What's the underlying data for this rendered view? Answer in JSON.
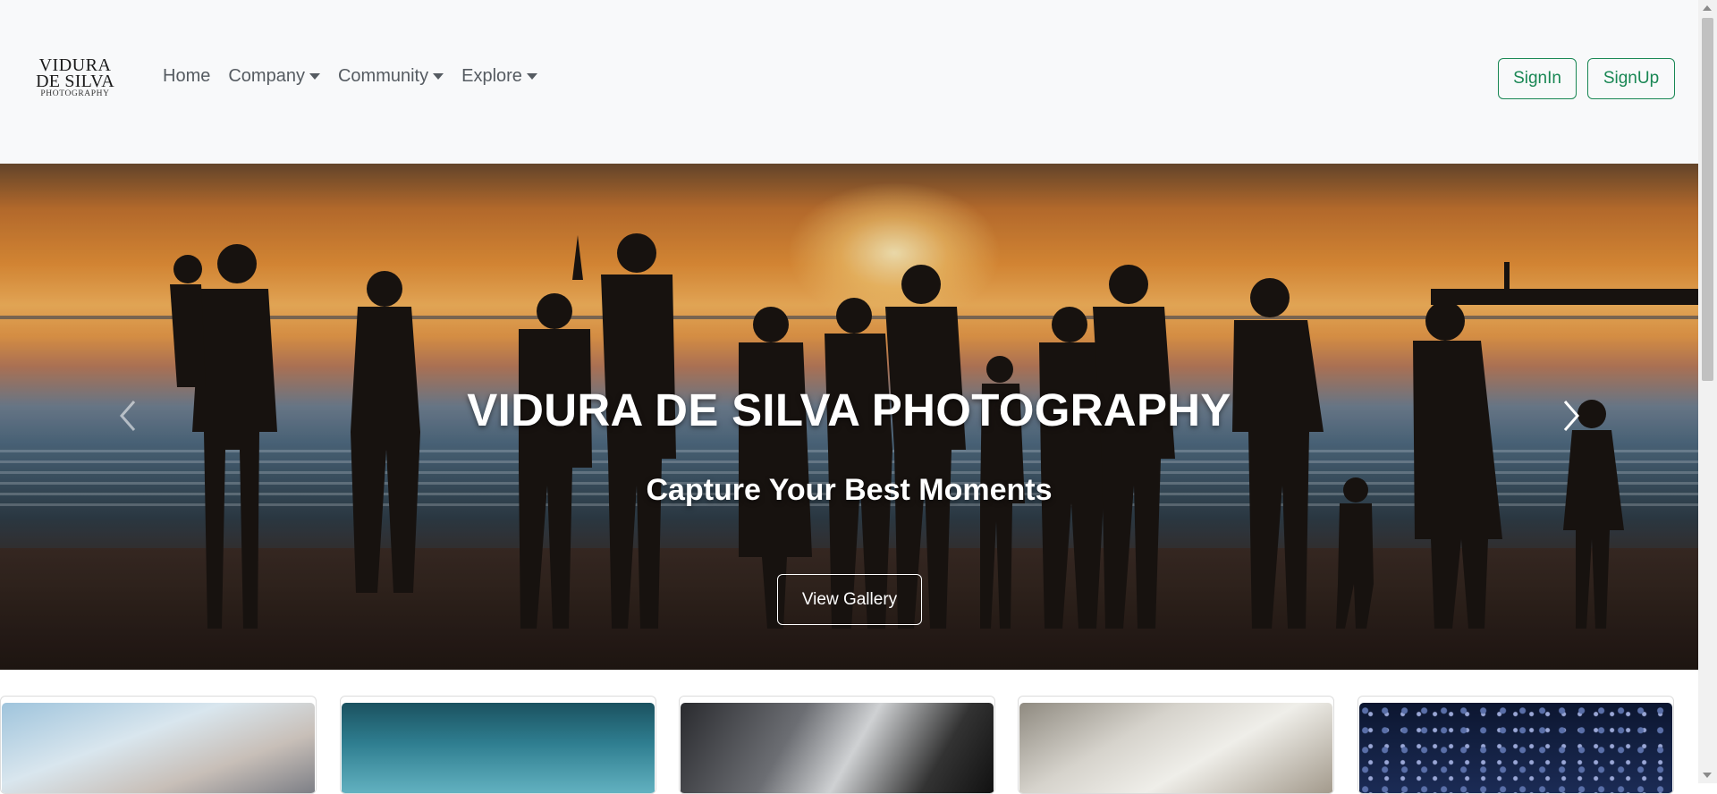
{
  "brand": {
    "line1": "VIDURA",
    "line2": "DE SILVA",
    "line3": "PHOTOGRAPHY"
  },
  "nav": {
    "items": [
      {
        "label": "Home",
        "dropdown": false
      },
      {
        "label": "Company",
        "dropdown": true
      },
      {
        "label": "Community",
        "dropdown": true
      },
      {
        "label": "Explore",
        "dropdown": true
      }
    ],
    "signin_label": "SignIn",
    "signup_label": "SignUp"
  },
  "hero": {
    "title": "VIDURA DE SILVA PHOTOGRAPHY",
    "subtitle": "Capture Your Best Moments",
    "button_label": "View Gallery",
    "prev_icon": "chevron-left-icon",
    "next_icon": "chevron-right-icon"
  },
  "cards": [
    {
      "image": "sky-with-birds"
    },
    {
      "image": "ocean-horizon"
    },
    {
      "image": "bride-dress-closeup"
    },
    {
      "image": "wedding-rings-lace"
    },
    {
      "image": "confetti-celebration"
    }
  ],
  "colors": {
    "accent": "#198754",
    "navbar_bg": "#f8f9fa",
    "nav_text": "#555b61"
  }
}
